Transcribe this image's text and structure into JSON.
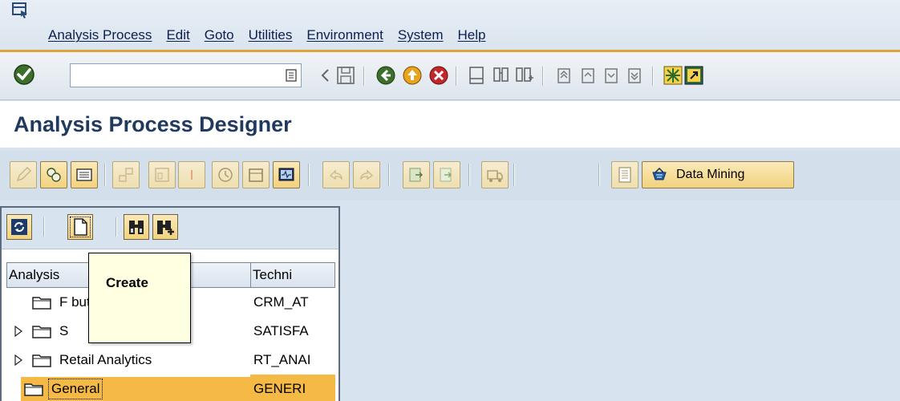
{
  "menu": {
    "items": [
      "Analysis Process",
      "Edit",
      "Goto",
      "Utilities",
      "Environment",
      "System",
      "Help"
    ]
  },
  "system_toolbar": {
    "command_value": "",
    "icons": [
      "enter-icon",
      "back-icon",
      "save-icon",
      "green-back-icon",
      "exit-icon",
      "cancel-icon",
      "print-icon",
      "find-icon",
      "find-next-icon",
      "first-page-icon",
      "previous-page-icon",
      "next-page-icon",
      "last-page-icon",
      "new-session-icon",
      "shortcut-icon"
    ]
  },
  "title": {
    "text": "Analysis Process Designer"
  },
  "app_toolbar": {
    "data_mining_label": "Data Mining"
  },
  "tree": {
    "columns": [
      "Analysis",
      "Techni"
    ],
    "rows": [
      {
        "name": "F          butes",
        "tech": "CRM_AT",
        "expandable": false,
        "selected": false
      },
      {
        "name": "S",
        "tech": "SATISFA",
        "expandable": true,
        "selected": false
      },
      {
        "name": "Retail Analytics",
        "tech": "RT_ANAI",
        "expandable": true,
        "selected": false
      },
      {
        "name": "General",
        "tech": "GENERI",
        "expandable": true,
        "selected": true
      }
    ]
  },
  "tooltip": {
    "text": "Create"
  },
  "colors": {
    "accent": "#e0a23a",
    "title": "#1f3a5e",
    "button": "#f2d27e",
    "selection": "#f5b945",
    "tooltip_bg": "#ffffe1"
  }
}
